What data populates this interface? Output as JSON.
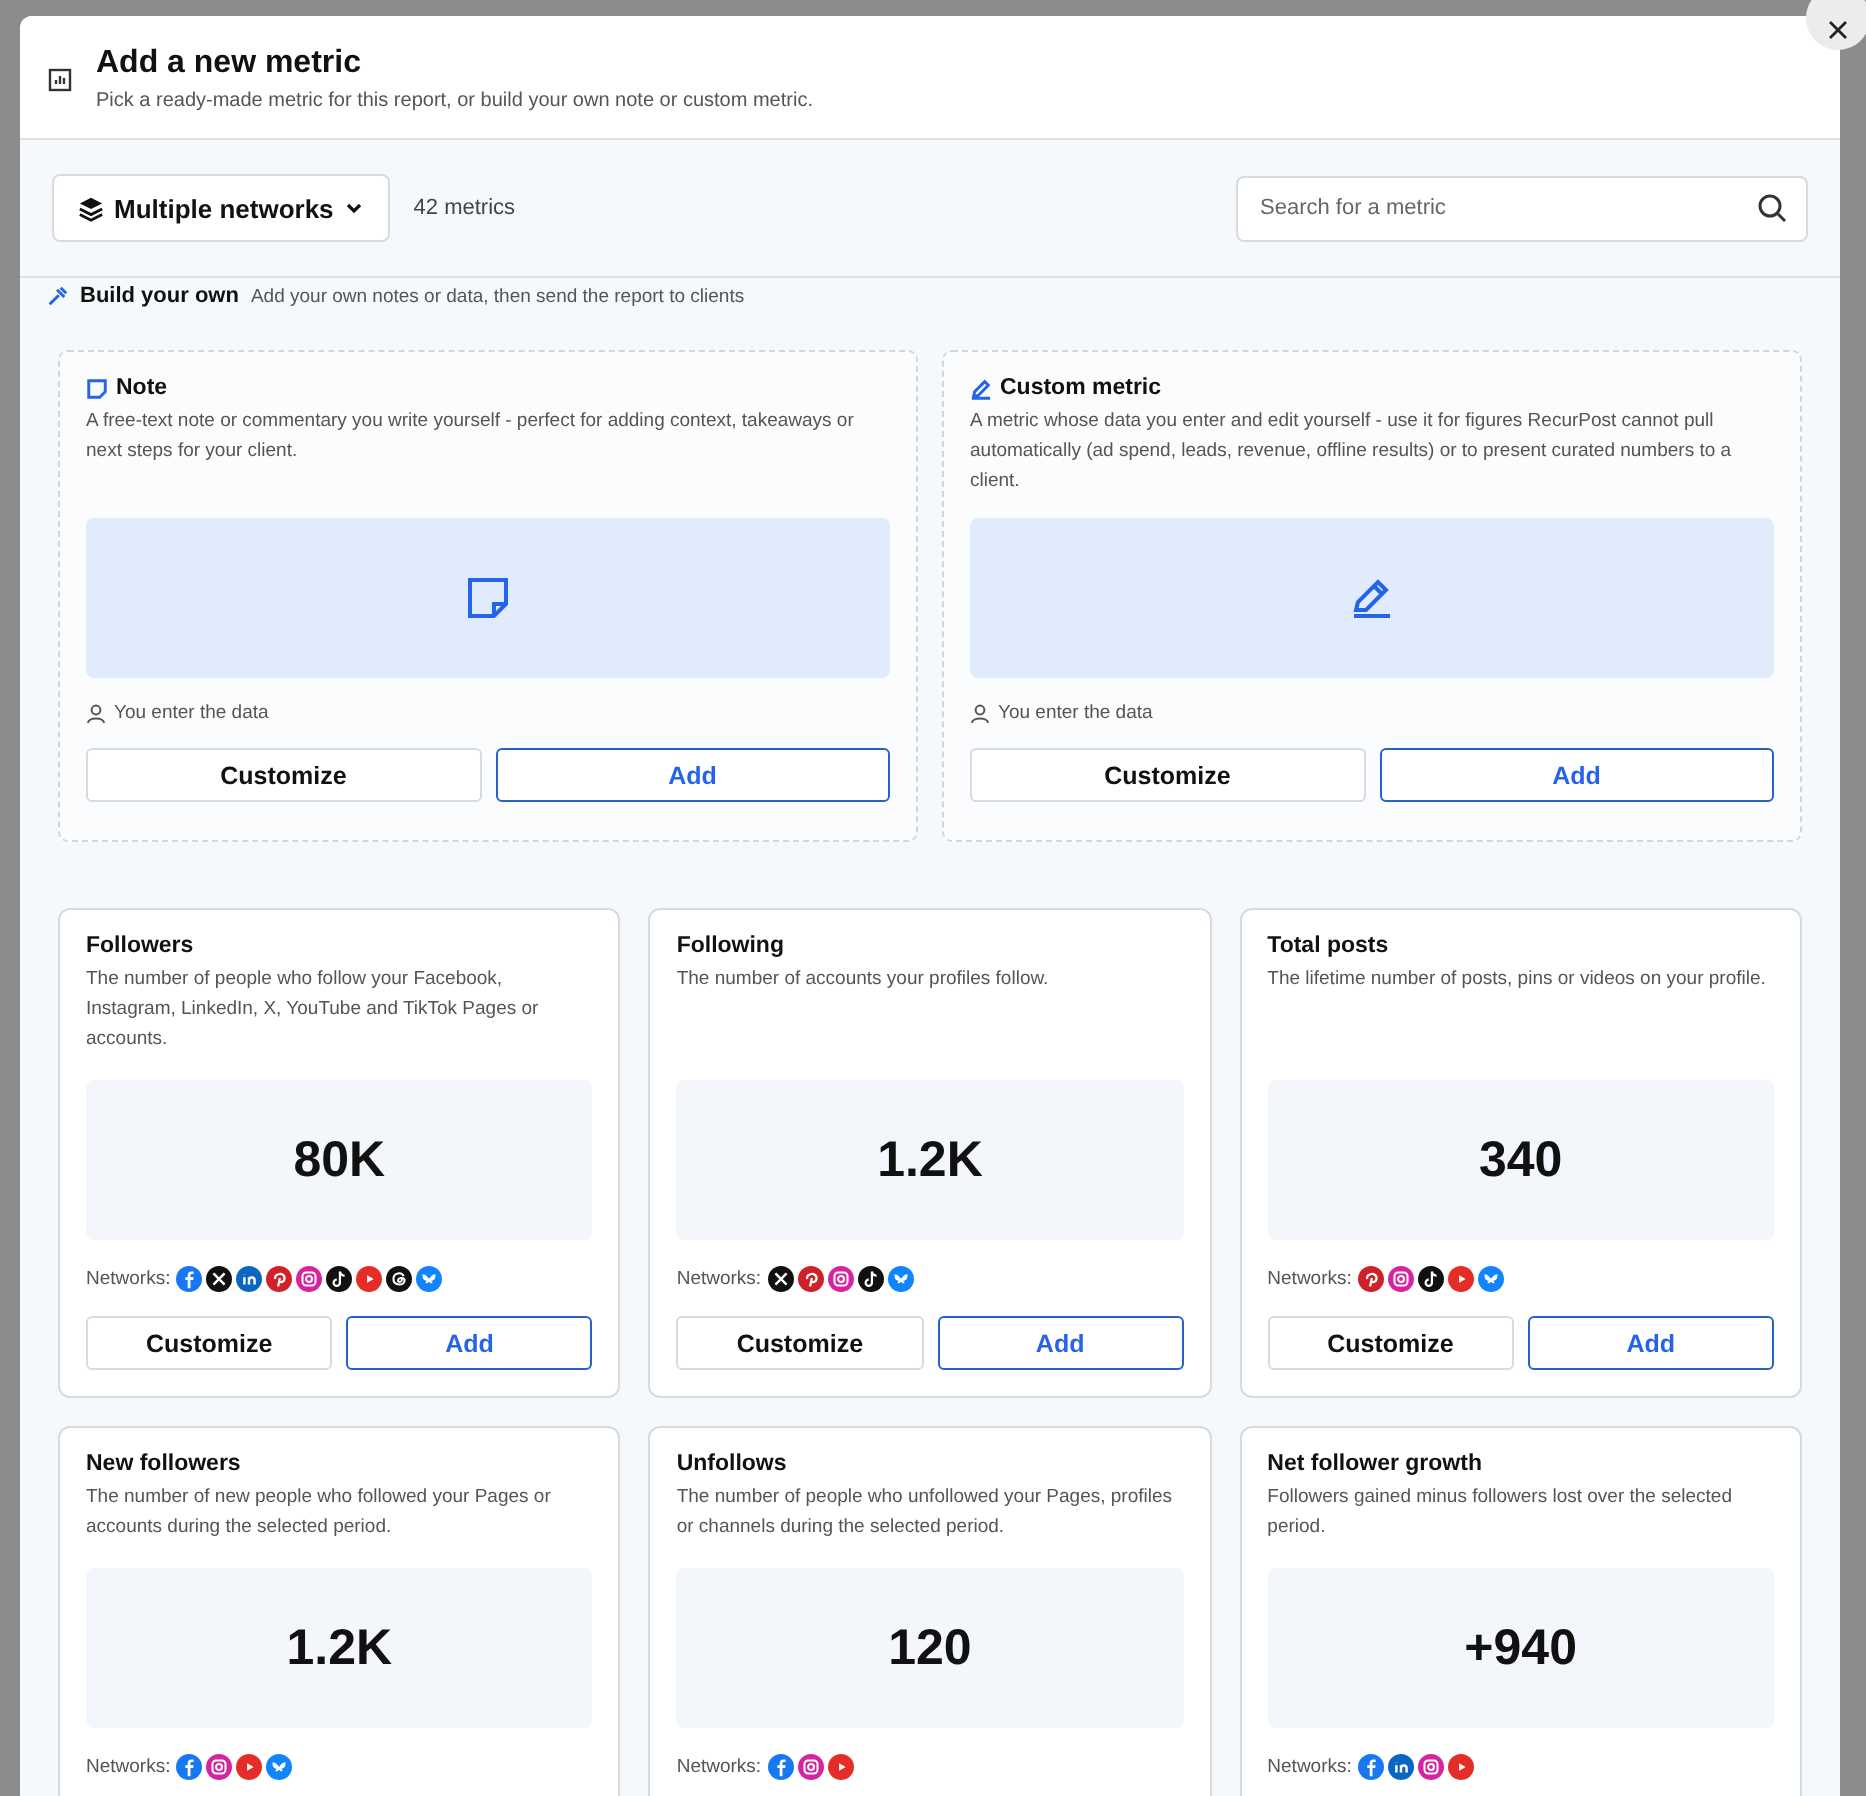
{
  "dialog": {
    "title": "Add a new metric",
    "subtitle": "Pick a ready-made metric for this report, or build your own note or custom metric."
  },
  "toolbar": {
    "network_filter": "Multiple networks",
    "count": "42 metrics",
    "search": {
      "placeholder": "Search for a metric"
    }
  },
  "build_your_own": {
    "title": "Build your own",
    "description": "Add your own notes or data, then send the report to clients",
    "cards": [
      {
        "kind": "note",
        "title": "Note",
        "description": "A free-text note or commentary you write yourself - perfect for adding context, takeaways or next steps for your client.",
        "source": "You enter the data",
        "buttons": [
          "Customize",
          "Add"
        ]
      },
      {
        "kind": "custom",
        "title": "Custom metric",
        "description": "A metric whose data you enter and edit yourself - use it for figures RecurPost cannot pull automatically (ad spend, leads, revenue, offline results) or to present curated numbers to a client.",
        "source": "You enter the data",
        "buttons": [
          "Customize",
          "Add"
        ]
      }
    ]
  },
  "metrics": [
    {
      "title": "Followers",
      "description": "The number of people who follow your Facebook, Instagram, LinkedIn, X, YouTube and TikTok Pages or accounts.",
      "value": "80K",
      "networks_label": "Networks:",
      "networks": [
        {
          "kind": "facebook"
        },
        {
          "kind": "x"
        },
        {
          "kind": "linkedin"
        },
        {
          "kind": "pinterest"
        },
        {
          "kind": "instagram"
        },
        {
          "kind": "tiktok"
        },
        {
          "kind": "youtube"
        },
        {
          "kind": "threads"
        },
        {
          "kind": "bluesky"
        }
      ],
      "buttons": [
        "Customize",
        "Add"
      ]
    },
    {
      "title": "Following",
      "description": "The number of accounts your profiles follow.",
      "value": "1.2K",
      "networks_label": "Networks:",
      "networks": [
        {
          "kind": "x"
        },
        {
          "kind": "pinterest"
        },
        {
          "kind": "instagram"
        },
        {
          "kind": "tiktok"
        },
        {
          "kind": "bluesky"
        }
      ],
      "buttons": [
        "Customize",
        "Add"
      ]
    },
    {
      "title": "Total posts",
      "description": "The lifetime number of posts, pins or videos on your profile.",
      "value": "340",
      "networks_label": "Networks:",
      "networks": [
        {
          "kind": "pinterest"
        },
        {
          "kind": "instagram"
        },
        {
          "kind": "tiktok"
        },
        {
          "kind": "youtube"
        },
        {
          "kind": "bluesky"
        }
      ],
      "buttons": [
        "Customize",
        "Add"
      ]
    },
    {
      "title": "New followers",
      "description": "The number of new people who followed your Pages or accounts during the selected period.",
      "value": "1.2K",
      "networks_label": "Networks:",
      "networks": [
        {
          "kind": "facebook"
        },
        {
          "kind": "instagram"
        },
        {
          "kind": "youtube"
        },
        {
          "kind": "bluesky"
        }
      ]
    },
    {
      "title": "Unfollows",
      "description": "The number of people who unfollowed your Pages, profiles or channels during the selected period.",
      "value": "120",
      "networks_label": "Networks:",
      "networks": [
        {
          "kind": "facebook"
        },
        {
          "kind": "instagram"
        },
        {
          "kind": "youtube"
        }
      ]
    },
    {
      "title": "Net follower growth",
      "description": "Followers gained minus followers lost over the selected period.",
      "value": "+940",
      "networks_label": "Networks:",
      "networks": [
        {
          "kind": "facebook"
        },
        {
          "kind": "linkedin"
        },
        {
          "kind": "instagram"
        },
        {
          "kind": "youtube"
        }
      ]
    }
  ]
}
